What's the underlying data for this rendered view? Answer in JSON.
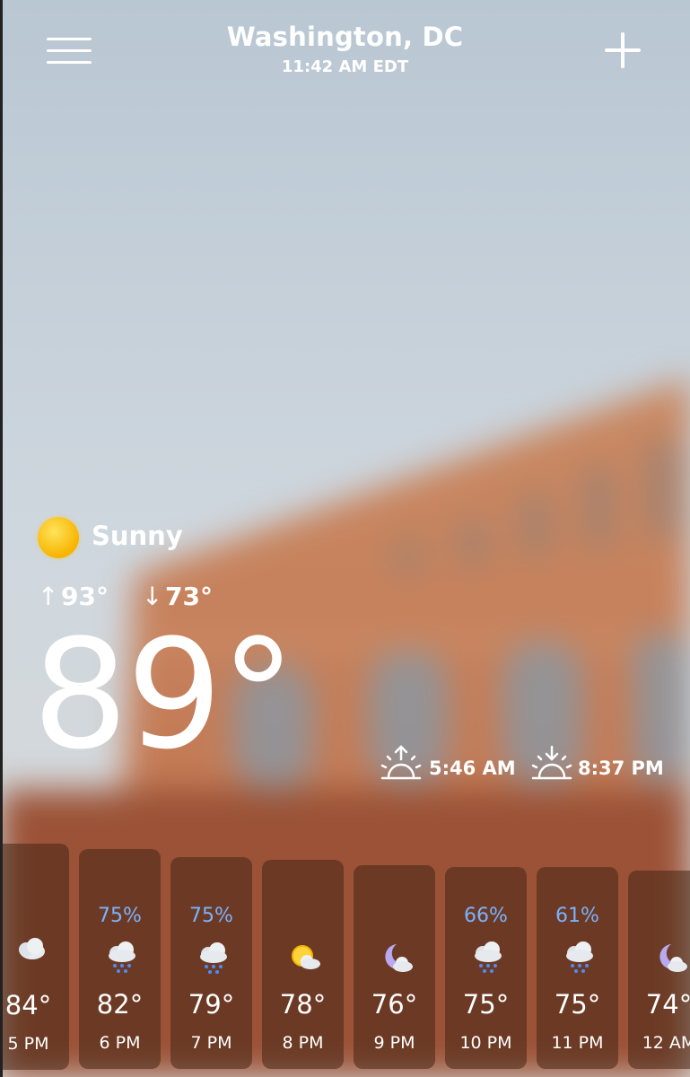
{
  "header": {
    "location": "Washington, DC",
    "local_time": "11:42 AM EDT",
    "menu_icon": "hamburger-menu-icon",
    "add_icon": "plus-icon"
  },
  "current": {
    "condition": "Sunny",
    "condition_icon": "sun-icon",
    "high_arrow": "↑",
    "high": "93°",
    "low_arrow": "↓",
    "low": "73°",
    "temperature": "89°",
    "sunrise": "5:46 AM",
    "sunset": "8:37 PM"
  },
  "hourly": [
    {
      "time": "5 PM",
      "temp": "84°",
      "precip": "",
      "icon": "cloudy-icon"
    },
    {
      "time": "6 PM",
      "temp": "82°",
      "precip": "75%",
      "icon": "rain-icon"
    },
    {
      "time": "7 PM",
      "temp": "79°",
      "precip": "75%",
      "icon": "rain-icon"
    },
    {
      "time": "8 PM",
      "temp": "78°",
      "precip": "",
      "icon": "partly-sunny-icon"
    },
    {
      "time": "9 PM",
      "temp": "76°",
      "precip": "",
      "icon": "moon-cloud-icon"
    },
    {
      "time": "10 PM",
      "temp": "75°",
      "precip": "66%",
      "icon": "rain-icon"
    },
    {
      "time": "11 PM",
      "temp": "75°",
      "precip": "61%",
      "icon": "rain-icon"
    },
    {
      "time": "12 AM",
      "temp": "74°",
      "precip": "",
      "icon": "moon-cloud-icon"
    }
  ],
  "colors": {
    "precip": "#7ab2ff",
    "sun": "#f7b400"
  }
}
